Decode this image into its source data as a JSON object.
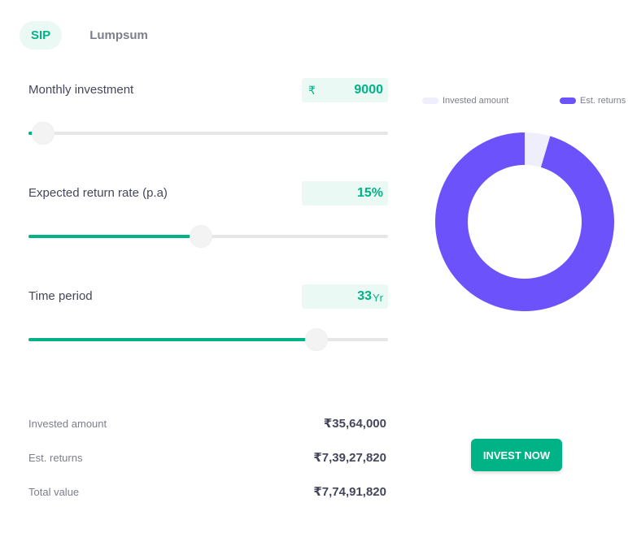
{
  "tabs": [
    {
      "label": "SIP",
      "active": true
    },
    {
      "label": "Lumpsum",
      "active": false
    }
  ],
  "inputs": {
    "monthly": {
      "label": "Monthly investment",
      "prefix": "₹",
      "value": "9000",
      "slider_fraction": 0.04
    },
    "rate": {
      "label": "Expected return rate (p.a)",
      "value": "15%",
      "slider_fraction": 0.48
    },
    "period": {
      "label": "Time period",
      "value": "33",
      "suffix": "Yr",
      "slider_fraction": 0.8
    }
  },
  "legend": {
    "invested": {
      "label": "Invested amount",
      "color": "#eeeefc"
    },
    "returns": {
      "label": "Est. returns",
      "color": "#6c52fb"
    }
  },
  "chart_data": {
    "type": "pie",
    "categories": [
      "Invested amount",
      "Est. returns"
    ],
    "values": [
      3564000,
      73927820
    ]
  },
  "summary": {
    "invested": {
      "label": "Invested amount",
      "value": "₹35,64,000"
    },
    "returns": {
      "label": "Est. returns",
      "value": "₹7,39,27,820"
    },
    "total": {
      "label": "Total value",
      "value": "₹7,74,91,820"
    }
  },
  "cta": {
    "label": "INVEST NOW"
  },
  "colors": {
    "accent": "#00b386",
    "accent_bg": "#ebf9f5"
  }
}
